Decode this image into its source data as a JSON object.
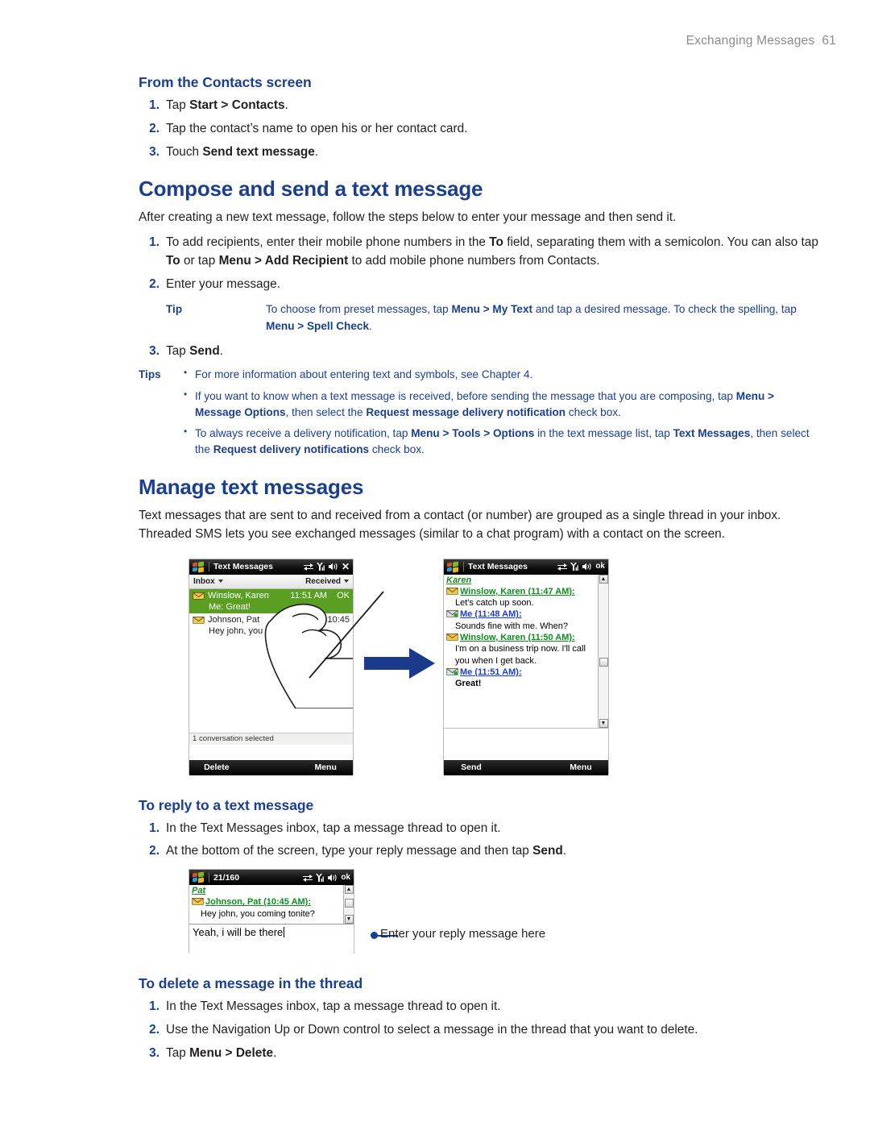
{
  "header": {
    "title": "Exchanging Messages",
    "page_number": "61"
  },
  "sections": {
    "from_contacts": {
      "heading": "From the Contacts screen",
      "steps": [
        {
          "num": "1.",
          "parts": [
            {
              "t": "Tap ",
              "b": false
            },
            {
              "t": "Start > Contacts",
              "b": true
            },
            {
              "t": ".",
              "b": false
            }
          ]
        },
        {
          "num": "2.",
          "parts": [
            {
              "t": "Tap the contact’s name to open his or her contact card.",
              "b": false
            }
          ]
        },
        {
          "num": "3.",
          "parts": [
            {
              "t": "Touch ",
              "b": false
            },
            {
              "t": "Send text message",
              "b": true
            },
            {
              "t": ".",
              "b": false
            }
          ]
        }
      ]
    },
    "compose": {
      "heading": "Compose and send a text message",
      "intro": "After creating a new text message, follow the steps below to enter your message and then send it.",
      "steps": [
        {
          "num": "1.",
          "parts": [
            {
              "t": "To add recipients, enter their mobile phone numbers in the ",
              "b": false
            },
            {
              "t": "To",
              "b": true
            },
            {
              "t": " field, separating them with a semicolon. You can also tap ",
              "b": false
            },
            {
              "t": "To",
              "b": true
            },
            {
              "t": " or tap ",
              "b": false
            },
            {
              "t": "Menu > Add Recipient",
              "b": true
            },
            {
              "t": " to add mobile phone numbers from Contacts.",
              "b": false
            }
          ]
        },
        {
          "num": "2.",
          "parts": [
            {
              "t": "Enter your message.",
              "b": false
            }
          ]
        },
        {
          "num": "3.",
          "parts": [
            {
              "t": "Tap ",
              "b": false
            },
            {
              "t": "Send",
              "b": true
            },
            {
              "t": ".",
              "b": false
            }
          ]
        }
      ],
      "tip": {
        "label": "Tip",
        "parts": [
          {
            "t": "To choose from preset messages, tap ",
            "b": false
          },
          {
            "t": "Menu > My Text",
            "b": true
          },
          {
            "t": " and tap a desired message. To check the spelling, tap ",
            "b": false
          },
          {
            "t": "Menu > Spell Check",
            "b": true
          },
          {
            "t": ".",
            "b": false
          }
        ]
      },
      "tips": {
        "label": "Tips",
        "items": [
          [
            {
              "t": "For more information about entering text and symbols, see Chapter 4.",
              "b": false
            }
          ],
          [
            {
              "t": "If you want to know when a text message is received, before sending the message that you are composing, tap ",
              "b": false
            },
            {
              "t": "Menu > Message Options",
              "b": true
            },
            {
              "t": ", then select the ",
              "b": false
            },
            {
              "t": "Request message delivery notification",
              "b": true
            },
            {
              "t": " check box.",
              "b": false
            }
          ],
          [
            {
              "t": "To always receive a delivery notification, tap ",
              "b": false
            },
            {
              "t": "Menu > Tools > Options",
              "b": true
            },
            {
              "t": " in the text message list, tap ",
              "b": false
            },
            {
              "t": "Text Messages",
              "b": true
            },
            {
              "t": ", then select the ",
              "b": false
            },
            {
              "t": "Request delivery notifications",
              "b": true
            },
            {
              "t": " check box.",
              "b": false
            }
          ]
        ]
      }
    },
    "manage": {
      "heading": "Manage text messages",
      "intro": "Text messages that are sent to and received from a contact (or number) are grouped as a single thread in your inbox. Threaded SMS lets you see exchanged messages (similar to a chat program) with a contact on the screen."
    },
    "reply": {
      "heading": "To reply to a text message",
      "steps": [
        {
          "num": "1.",
          "parts": [
            {
              "t": "In the Text Messages inbox, tap a message thread to open it.",
              "b": false
            }
          ]
        },
        {
          "num": "2.",
          "parts": [
            {
              "t": "At the bottom of the screen, type your reply message and then tap ",
              "b": false
            },
            {
              "t": "Send",
              "b": true
            },
            {
              "t": ".",
              "b": false
            }
          ]
        }
      ],
      "callout": "Enter your reply message here"
    },
    "delete": {
      "heading": "To delete a message in the thread",
      "steps": [
        {
          "num": "1.",
          "parts": [
            {
              "t": "In the Text Messages inbox, tap a message thread to open it.",
              "b": false
            }
          ]
        },
        {
          "num": "2.",
          "parts": [
            {
              "t": "Use the Navigation Up or Down control to select a message in the thread that you want to delete.",
              "b": false
            }
          ]
        },
        {
          "num": "3.",
          "parts": [
            {
              "t": "Tap ",
              "b": false
            },
            {
              "t": "Menu > Delete",
              "b": true
            },
            {
              "t": ".",
              "b": false
            }
          ]
        }
      ]
    }
  },
  "figures": {
    "inbox_device": {
      "title": "Text Messages",
      "title_icons": [
        "connection-icon",
        "signal-icon",
        "speaker-icon",
        "close-icon"
      ],
      "filter_left": "Inbox",
      "filter_right": "Received",
      "rows": [
        {
          "name": "Winslow, Karen",
          "time": "11:51 AM",
          "status": "OK",
          "preview": "Me: Great!",
          "selected": true
        },
        {
          "name": "Johnson, Pat",
          "time": "10:45",
          "status": "",
          "preview": "Hey john, you coming tonite?",
          "selected": false
        }
      ],
      "status_text": "1 conversation selected",
      "softkeys": {
        "left": "Delete",
        "center": "keyboard-icon",
        "right": "Menu"
      }
    },
    "thread_device": {
      "title": "Text Messages",
      "title_icons": [
        "connection-icon",
        "signal-icon",
        "speaker-icon"
      ],
      "ok_label": "ok",
      "contact_header": "Karen",
      "messages": [
        {
          "from": "Winslow, Karen (11:47 AM):",
          "who": "green",
          "text": "Let's catch up soon."
        },
        {
          "from": "Me (11:48 AM):",
          "who": "blue",
          "text": "Sounds fine with me. When?"
        },
        {
          "from": "Winslow, Karen (11:50 AM):",
          "who": "green",
          "text": "I'm on a business trip now. I'll call you when I get back."
        },
        {
          "from": "Me (11:51 AM):",
          "who": "blue",
          "text": "Great!",
          "bold": true
        }
      ],
      "softkeys": {
        "left": "Send",
        "center": "keyboard-icon",
        "right": "Menu"
      }
    },
    "reply_device": {
      "title": "21/160",
      "title_icons": [
        "connection-icon",
        "signal-icon",
        "speaker-icon"
      ],
      "ok_label": "ok",
      "contact_header": "Pat",
      "messages": [
        {
          "from": "Johnson, Pat (10:45 AM):",
          "who": "green",
          "text": "Hey john, you coming tonite?"
        }
      ],
      "reply_value": "Yeah, i will be there"
    }
  },
  "colors": {
    "heading_blue": "#1b3f8f",
    "accent_blue": "#1b3f8f",
    "selection_green": "#5a9e22",
    "sender_green": "#0a8f1e",
    "sender_blue": "#1a3ecb",
    "header_gray": "#8c8c8c"
  }
}
